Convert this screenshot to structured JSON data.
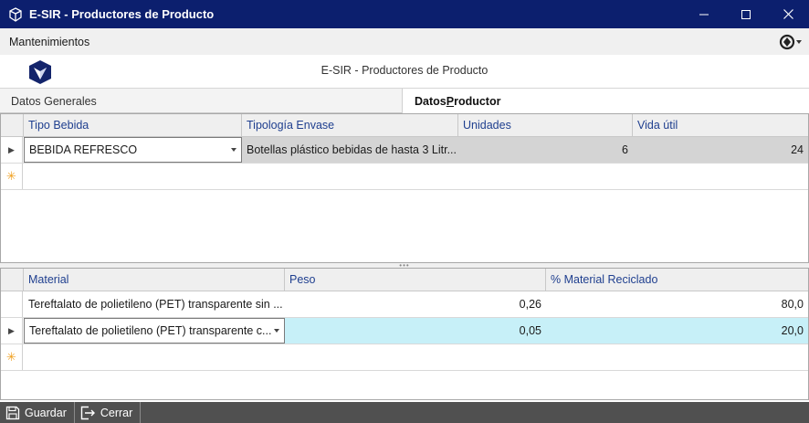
{
  "window": {
    "title": "E-SIR - Productores de Producto",
    "minimize_icon": "minimize-icon",
    "maximize_icon": "maximize-icon",
    "close_icon": "close-icon"
  },
  "menu": {
    "item": "Mantenimientos",
    "nav_icon": "navigation-compass-icon"
  },
  "header": {
    "title": "E-SIR - Productores de Producto",
    "logo": "esir-logo"
  },
  "tabs": [
    {
      "label": "Datos Generales",
      "active": false
    },
    {
      "label": "Datos Productor",
      "active": true
    }
  ],
  "grid_bebidas": {
    "columns": [
      "Tipo Bebida",
      "Tipología Envase",
      "Unidades",
      "Vida útil"
    ],
    "rows": [
      {
        "tipo_bebida": "BEBIDA REFRESCO",
        "tipologia": "Botellas plástico bebidas de hasta 3 Litr...",
        "unidades": "6",
        "vida_util": "24"
      }
    ]
  },
  "grid_materiales": {
    "columns": [
      "Material",
      "Peso",
      "% Material Reciclado"
    ],
    "rows": [
      {
        "material": "Tereftalato de polietileno (PET) transparente sin ...",
        "peso": "0,26",
        "reciclado": "80,0"
      },
      {
        "material": "Tereftalato de polietileno (PET) transparente c...",
        "peso": "0,05",
        "reciclado": "20,0"
      }
    ]
  },
  "statusbar": {
    "save_label": "Guardar",
    "close_label": "Cerrar"
  },
  "colors": {
    "titlebar": "#0c1f6e",
    "selected_row": "#c7f0f8",
    "header_text": "#1f3f8f"
  }
}
